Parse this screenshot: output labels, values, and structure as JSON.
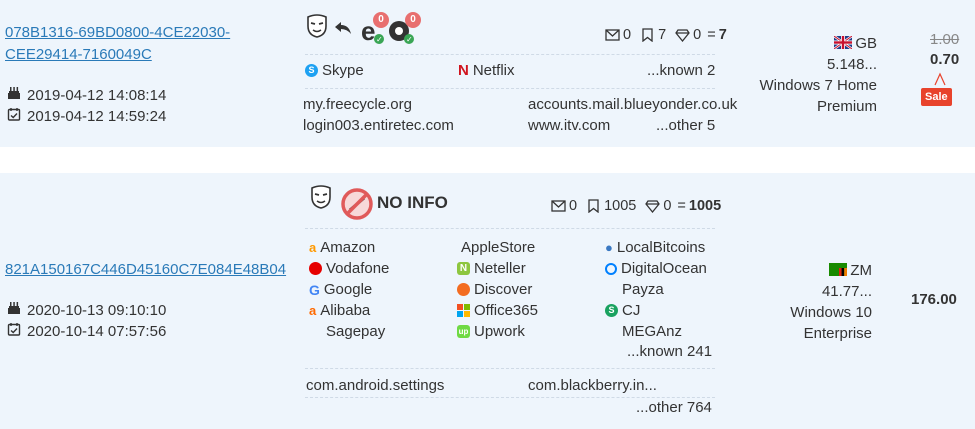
{
  "rows": [
    {
      "id_line1": "078B1316-69BD0800-4CE22030-",
      "id_line2": "CEE29414-7160049C",
      "date_created": "2019-04-12 14:08:14",
      "date_seen": "2019-04-12 14:59:24",
      "badge_a": "0",
      "badge_b": "0",
      "services": [
        "Skype",
        "Netflix",
        "...known 2"
      ],
      "domains": [
        "my.freecycle.org",
        "accounts.mail.blueyonder.co.uk",
        "login003.entiretec.com",
        "www.itv.com",
        "...other 5"
      ],
      "stats": {
        "mail": "0",
        "bookmarks": "7",
        "gems": "0",
        "eq": "=",
        "total": "7"
      },
      "country": "GB",
      "ip": "5.148...",
      "os_line1": "Windows 7 Home",
      "os_line2": "Premium",
      "price_old": "1.00",
      "price": "0.70",
      "sale": "Sale"
    },
    {
      "id": "821A150167C446D45160C7E084E48B04",
      "date_created": "2020-10-13 09:10:10",
      "date_seen": "2020-10-14 07:57:56",
      "no_info": "NO INFO",
      "services_col1": [
        "Amazon",
        "Vodafone",
        "Google",
        "Alibaba",
        "Sagepay"
      ],
      "services_col2": [
        "AppleStore",
        "Neteller",
        "Discover",
        "Office365",
        "Upwork"
      ],
      "services_col3": [
        "LocalBitcoins",
        "DigitalOcean",
        "Payza",
        "CJ",
        "MEGAnz",
        "...known 241"
      ],
      "domains": [
        "com.android.settings",
        "com.blackberry.in...",
        "...other 764"
      ],
      "stats": {
        "mail": "0",
        "bookmarks": "1005",
        "gems": "0",
        "eq": "=",
        "total": "1005"
      },
      "country": "ZM",
      "ip": "41.77...",
      "os_line1": "Windows 10",
      "os_line2": "Enterprise",
      "price": "176.00"
    }
  ],
  "colors": {
    "row_bg": "#eef5fc",
    "link": "#2a7ab8",
    "sale": "#e8432c",
    "badge": "#e86f6f"
  }
}
